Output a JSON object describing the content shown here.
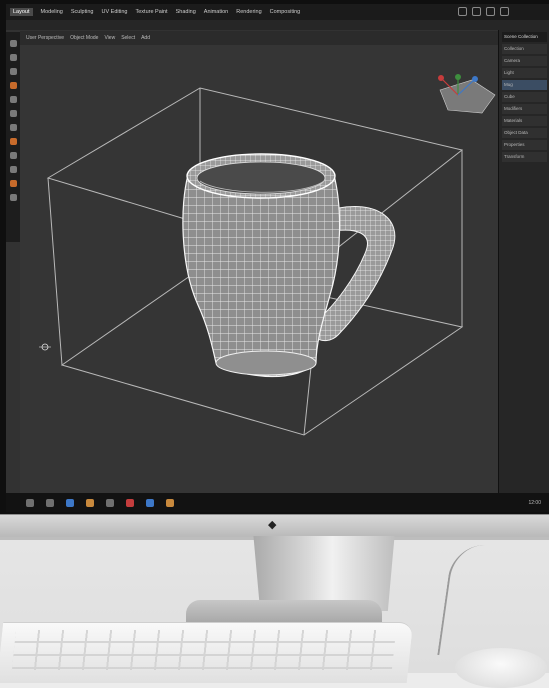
{
  "menu": {
    "items": [
      "Layout",
      "Modeling",
      "Sculpting",
      "UV Editing",
      "Texture Paint",
      "Shading",
      "Animation",
      "Rendering",
      "Compositing"
    ],
    "active_index": 0
  },
  "viewport": {
    "tabs": [
      "User Perspective",
      "Object Mode",
      "View",
      "Select",
      "Add"
    ]
  },
  "outliner": {
    "header": "Scene Collection",
    "rows": [
      "Collection",
      "Camera",
      "Light",
      "Mug",
      "Cube",
      "Modifiers",
      "Materials",
      "Object Data",
      "Properties",
      "Transform"
    ],
    "selected_index": 3
  },
  "taskbar": {
    "clock": "12:00"
  },
  "monitor": {
    "logo": "◆"
  },
  "colors": {
    "viewport_bg": "#353535",
    "ui_dark": "#1b1b1b",
    "accent_orange": "#c86b2b",
    "accent_blue": "#3d78c8"
  }
}
